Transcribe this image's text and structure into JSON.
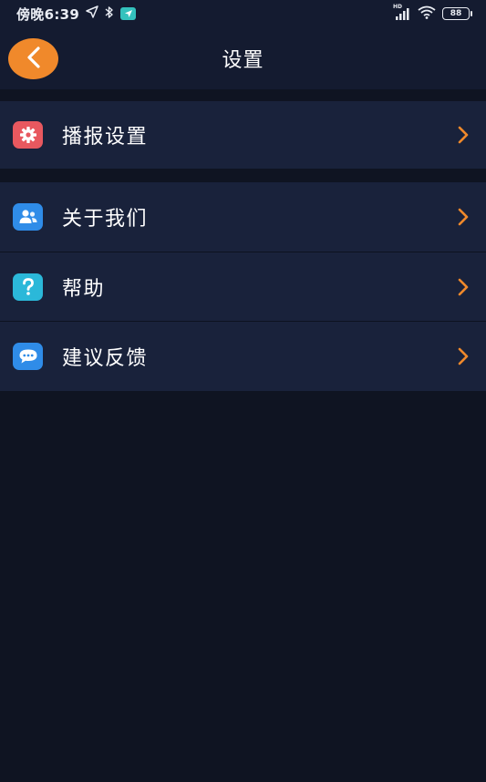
{
  "status_bar": {
    "time": "傍晚6:39",
    "network_label": "HD",
    "battery": "88"
  },
  "header": {
    "title": "设置"
  },
  "menu_groups": [
    {
      "items": [
        {
          "label": "播报设置",
          "icon": "gear-icon",
          "color": "#e8585f"
        }
      ]
    },
    {
      "items": [
        {
          "label": "关于我们",
          "icon": "people-icon",
          "color": "#2f8ce8"
        },
        {
          "label": "帮助",
          "icon": "question-icon",
          "color": "#2bb8d9"
        },
        {
          "label": "建议反馈",
          "icon": "chat-bubble-icon",
          "color": "#2f8ce8"
        }
      ]
    }
  ],
  "colors": {
    "background": "#0f1422",
    "card": "#19223b",
    "accent": "#f0892b"
  }
}
